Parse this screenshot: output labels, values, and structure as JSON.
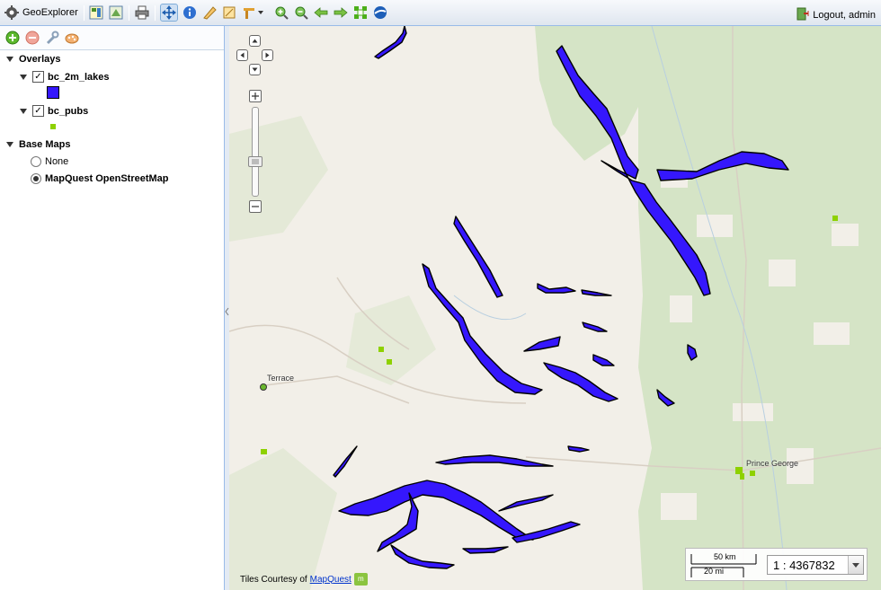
{
  "app": {
    "title": "GeoExplorer"
  },
  "header": {
    "logout_label": "Logout, admin"
  },
  "toolbar": {
    "icons": [
      "layer-properties-icon",
      "layer-styles-icon",
      "print-icon",
      "pan-icon",
      "info-icon",
      "measure-length-icon",
      "measure-area-icon",
      "zoom-in-icon",
      "zoom-out-icon",
      "navigate-back-icon",
      "navigate-forward-icon",
      "zoom-extent-icon",
      "google-earth-icon"
    ]
  },
  "layers": {
    "overlays_label": "Overlays",
    "items": [
      {
        "name": "bc_2m_lakes",
        "checked": true,
        "swatch": "#3517fd"
      },
      {
        "name": "bc_pubs",
        "checked": true,
        "swatch": "#8ed100"
      }
    ],
    "basemaps_label": "Base Maps",
    "basemaps": [
      {
        "name": "None",
        "selected": false
      },
      {
        "name": "MapQuest OpenStreetMap",
        "selected": true
      }
    ]
  },
  "map": {
    "cities": [
      "Terrace",
      "Prince George"
    ],
    "attribution_prefix": "Tiles Courtesy of",
    "attribution_link": "MapQuest",
    "scale_km": "50 km",
    "scale_mi": "20 mi",
    "scale_value": "1 : 4367832",
    "colors": {
      "lakes": "#3517fd",
      "pubs": "#8ed100",
      "background": "#f2efe8",
      "forest": "#d8e5c8"
    }
  }
}
